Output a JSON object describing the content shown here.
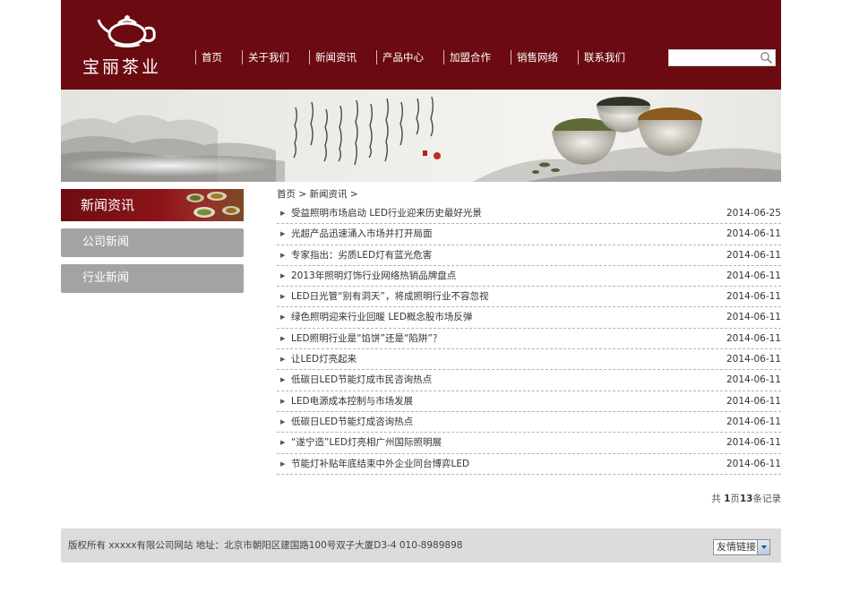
{
  "header": {
    "logo_text": "宝丽茶业",
    "nav": [
      "首页",
      "关于我们",
      "新闻资讯",
      "产品中心",
      "加盟合作",
      "销售网络",
      "联系我们"
    ],
    "search": {
      "value": "",
      "placeholder": ""
    }
  },
  "sidebar": {
    "title": "新闻资讯",
    "items": [
      "公司新闻",
      "行业新闻"
    ]
  },
  "breadcrumb": {
    "home": "首页",
    "sep": ">",
    "current": "新闻资讯",
    "sep_end": ">"
  },
  "news": [
    {
      "title": "受益照明市场启动 LED行业迎来历史最好光景",
      "date": "2014-06-25"
    },
    {
      "title": "光超产品迅速涌入市场并打开局面",
      "date": "2014-06-11"
    },
    {
      "title": "专家指出：劣质LED灯有蓝光危害",
      "date": "2014-06-11"
    },
    {
      "title": "2013年照明灯饰行业网络热销品牌盘点",
      "date": "2014-06-11"
    },
    {
      "title": "LED日光管“别有洞天”，将成照明行业不容忽视",
      "date": "2014-06-11"
    },
    {
      "title": "绿色照明迎来行业回暖 LED概念股市场反弹",
      "date": "2014-06-11"
    },
    {
      "title": "LED照明行业是“馅饼”还是“陷阱”？",
      "date": "2014-06-11"
    },
    {
      "title": "让LED灯亮起来",
      "date": "2014-06-11"
    },
    {
      "title": "低碳日LED节能灯成市民咨询热点",
      "date": "2014-06-11"
    },
    {
      "title": "LED电源成本控制与市场发展",
      "date": "2014-06-11"
    },
    {
      "title": "低碳日LED节能灯成咨询热点",
      "date": "2014-06-11"
    },
    {
      "title": "“遂宁造”LED灯亮相广州国际照明展",
      "date": "2014-06-11"
    },
    {
      "title": "节能灯补贴年底结束中外企业同台博弈LED",
      "date": "2014-06-11"
    }
  ],
  "pagination": {
    "prefix": "共",
    "page_num": "1",
    "page_word": "页",
    "record_num": "13",
    "record_word": "条记录"
  },
  "footer": {
    "copyright": "版权所有 xxxxx有限公司网站 地址：北京市朝阳区建国路100号双子大厦D3-4 010-8989898",
    "links_select": "友情链接"
  },
  "colors": {
    "brand_red": "#6b0b11",
    "sidebar_gray": "#a3a3a3",
    "footer_gray": "#dcdcdc"
  }
}
